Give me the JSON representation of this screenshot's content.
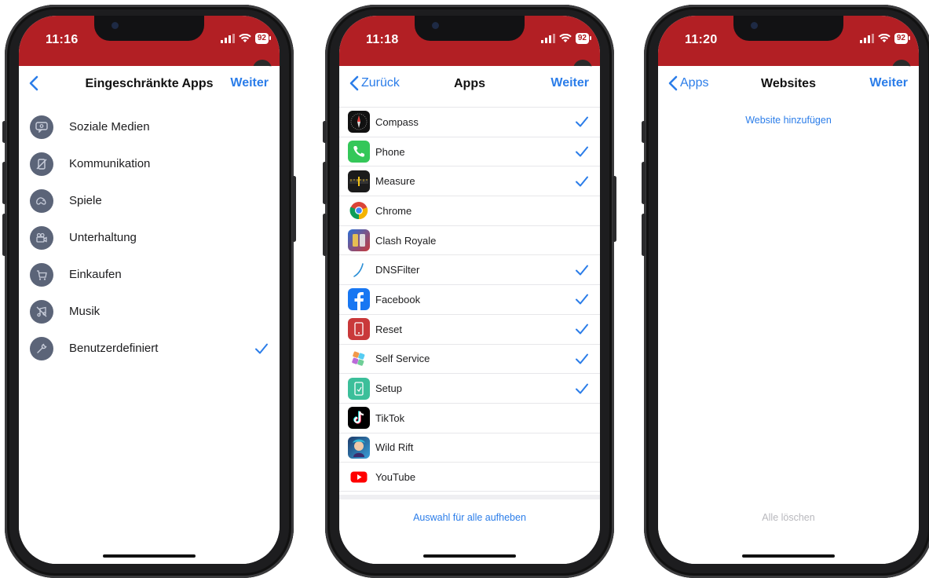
{
  "phone1": {
    "time": "11:16",
    "battery": "92",
    "nav": {
      "back_label": "",
      "title": "Eingeschränkte Apps",
      "right_label": "Weiter"
    },
    "categories": [
      {
        "label": "Soziale Medien",
        "icon": "chat-bubble-icon",
        "checked": false
      },
      {
        "label": "Kommunikation",
        "icon": "phone-slash-icon",
        "checked": false
      },
      {
        "label": "Spiele",
        "icon": "gamepad-icon",
        "checked": false
      },
      {
        "label": "Unterhaltung",
        "icon": "video-camera-icon",
        "checked": false
      },
      {
        "label": "Einkaufen",
        "icon": "shopping-cart-icon",
        "checked": false
      },
      {
        "label": "Musik",
        "icon": "music-off-icon",
        "checked": false
      },
      {
        "label": "Benutzerdefiniert",
        "icon": "wrench-icon",
        "checked": true
      }
    ]
  },
  "phone2": {
    "time": "11:18",
    "battery": "92",
    "nav": {
      "back_label": "Zurück",
      "title": "Apps",
      "right_label": "Weiter"
    },
    "apps": [
      {
        "label": "Compass",
        "icon": "compass-icon",
        "checked": true
      },
      {
        "label": "Phone",
        "icon": "phone-icon",
        "checked": true
      },
      {
        "label": "Measure",
        "icon": "measure-icon",
        "checked": true
      },
      {
        "label": "Chrome",
        "icon": "chrome-icon",
        "checked": false
      },
      {
        "label": "Clash Royale",
        "icon": "clash-royale-icon",
        "checked": false
      },
      {
        "label": "DNSFilter",
        "icon": "dnsfilter-icon",
        "checked": true
      },
      {
        "label": "Facebook",
        "icon": "facebook-icon",
        "checked": true
      },
      {
        "label": "Reset",
        "icon": "reset-icon",
        "checked": true
      },
      {
        "label": "Self Service",
        "icon": "self-service-icon",
        "checked": true
      },
      {
        "label": "Setup",
        "icon": "setup-icon",
        "checked": true
      },
      {
        "label": "TikTok",
        "icon": "tiktok-icon",
        "checked": false
      },
      {
        "label": "Wild Rift",
        "icon": "wild-rift-icon",
        "checked": false
      },
      {
        "label": "YouTube",
        "icon": "youtube-icon",
        "checked": false
      }
    ],
    "footer_label": "Auswahl für alle aufheben"
  },
  "phone3": {
    "time": "11:20",
    "battery": "92",
    "nav": {
      "back_label": "Apps",
      "title": "Websites",
      "right_label": "Weiter"
    },
    "add_label": "Website hinzufügen",
    "clear_label": "Alle löschen"
  },
  "colors": {
    "status_red": "#b21f24",
    "accent_blue": "#2b7de9",
    "icon_slate": "#5b6478"
  }
}
